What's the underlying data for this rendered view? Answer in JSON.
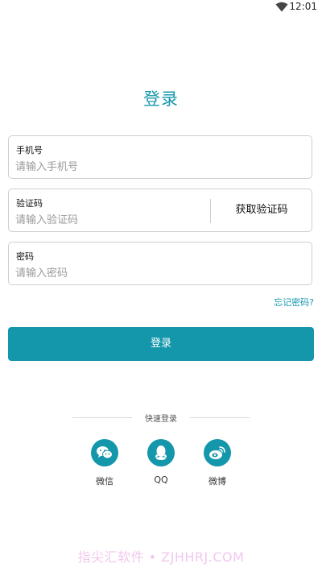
{
  "status_bar": {
    "time": "12:01"
  },
  "title": "登录",
  "fields": {
    "phone": {
      "label": "手机号",
      "placeholder": "请输入手机号",
      "value": ""
    },
    "code": {
      "label": "验证码",
      "placeholder": "请输入验证码",
      "value": "",
      "button_label": "获取验证码"
    },
    "password": {
      "label": "密码",
      "placeholder": "请输入密码",
      "value": ""
    }
  },
  "forgot_password": "忘记密码?",
  "login_button": "登录",
  "quick_login": {
    "title": "快速登录",
    "options": [
      {
        "label": "微信",
        "icon": "wechat-icon"
      },
      {
        "label": "QQ",
        "icon": "qq-icon"
      },
      {
        "label": "微博",
        "icon": "weibo-icon"
      }
    ]
  },
  "watermark": "指尖汇软件 • ZJHHRJ.COM",
  "colors": {
    "accent": "#1497ab",
    "border": "#cfcfcf",
    "watermark": "#f2c8ee"
  }
}
